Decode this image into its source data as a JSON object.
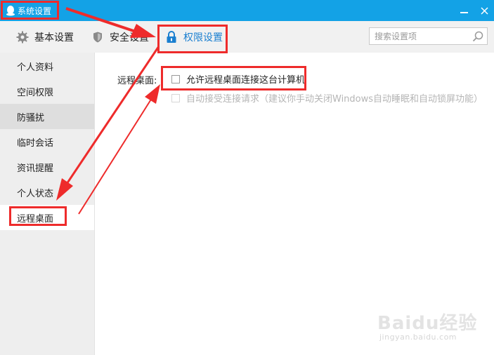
{
  "window": {
    "title": "系统设置",
    "minimize_label": "—",
    "close_label": "✕"
  },
  "tabs": [
    {
      "label": "基本设置",
      "icon": "gear-icon"
    },
    {
      "label": "安全设置",
      "icon": "shield-icon"
    },
    {
      "label": "权限设置",
      "icon": "lock-icon",
      "active": true
    }
  ],
  "search": {
    "placeholder": "搜索设置项"
  },
  "sidebar": {
    "items": [
      {
        "label": "个人资料"
      },
      {
        "label": "空间权限"
      },
      {
        "label": "防骚扰"
      },
      {
        "label": "临时会话"
      },
      {
        "label": "资讯提醒"
      },
      {
        "label": "个人状态"
      },
      {
        "label": "远程桌面",
        "active": true
      }
    ]
  },
  "remote_desktop": {
    "section_label": "远程桌面:",
    "allow_label": "允许远程桌面连接这台计算机",
    "allow_checked": false,
    "auto_accept_label": "自动接受连接请求（建议你手动关闭Windows自动睡眠和自动锁屏功能）",
    "auto_accept_checked": false,
    "auto_accept_enabled": false
  },
  "watermark": {
    "main": "Baidu经验",
    "sub": "jingyan.baidu.com"
  },
  "colors": {
    "titlebar": "#13a2e6",
    "accent": "#1a7fd0",
    "annotation_red": "#ee2b2b",
    "sidebar_bg": "#eeeeee",
    "tabbar_bg": "#f1f1f1"
  }
}
